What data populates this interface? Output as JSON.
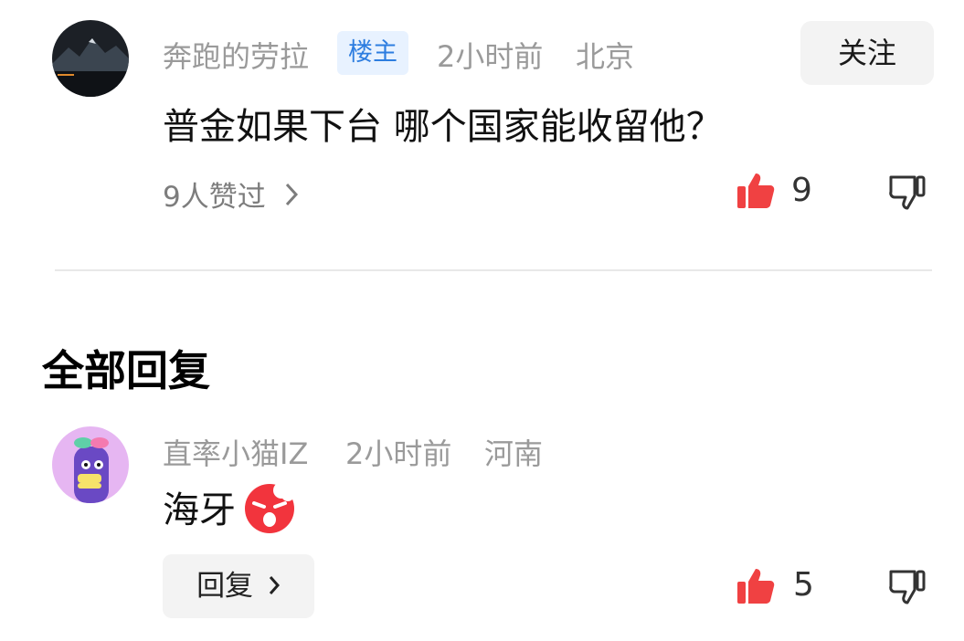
{
  "comment": {
    "username": "奔跑的劳拉",
    "tag": "楼主",
    "time": "2小时前",
    "location": "北京",
    "follow_label": "关注",
    "content": "普金如果下台 哪个国家能收留他？",
    "liked_by": "9人赞过",
    "like_count": "9",
    "avatar_icon": "mountain-lake-avatar"
  },
  "section_title": "全部回复",
  "reply": {
    "username": "直率小猫IZ",
    "time": "2小时前",
    "location": "河南",
    "content": "海牙",
    "emoji_icon": "angry-face-emoji",
    "reply_label": "回复",
    "like_count": "5",
    "avatar_icon": "purple-cartoon-avatar"
  },
  "colors": {
    "like_red": "#f04142",
    "tag_bg": "#e8f2ff",
    "tag_text": "#2d7de0",
    "meta_gray": "#9a9a9a"
  }
}
